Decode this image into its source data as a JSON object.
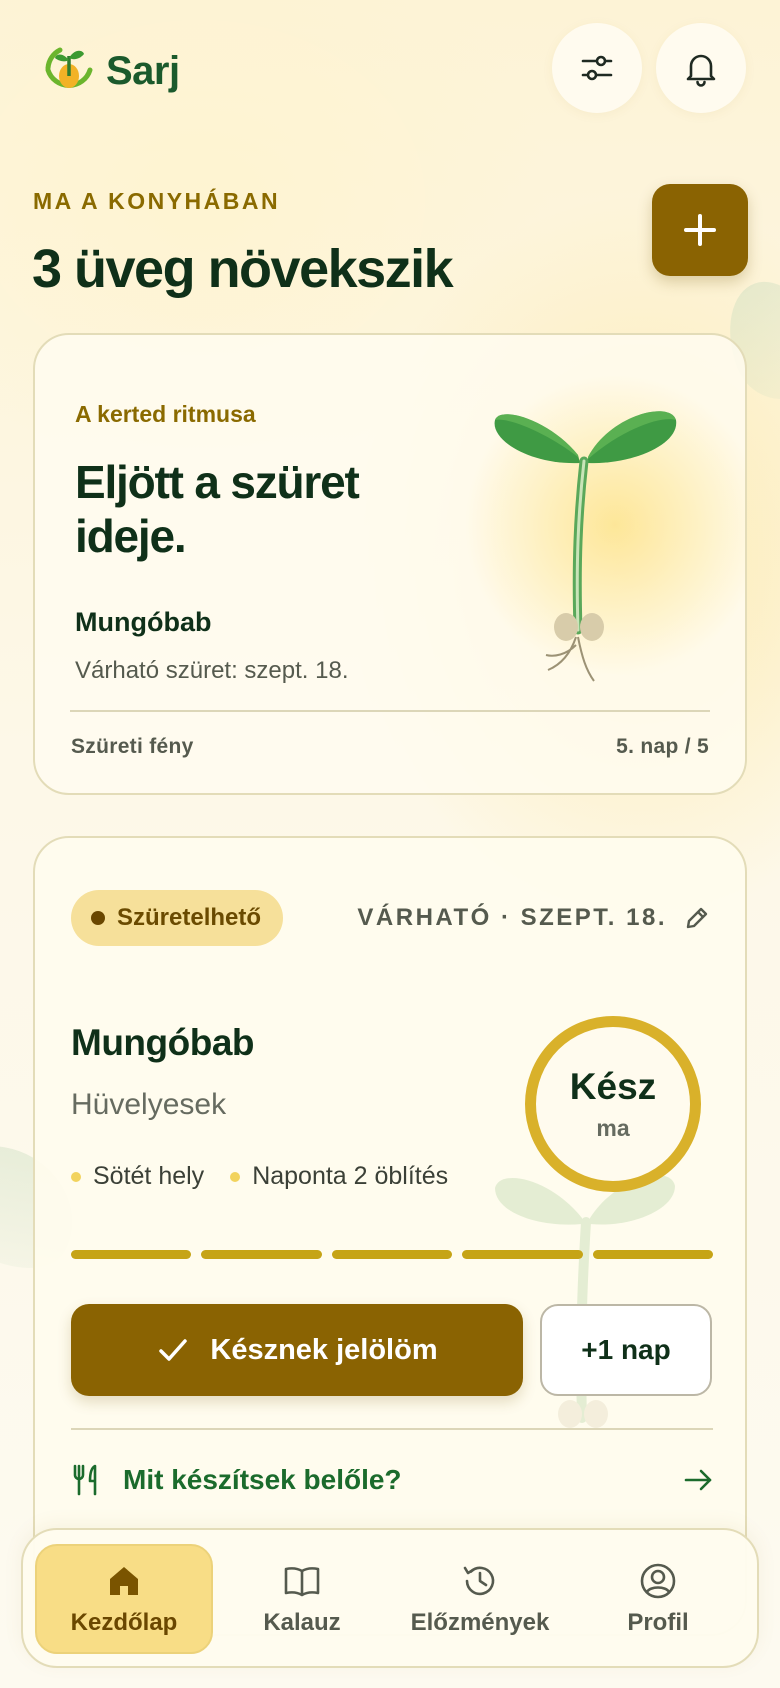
{
  "app": {
    "name": "Sarj"
  },
  "header": {
    "filter_icon": "sliders-icon",
    "bell_icon": "bell-icon"
  },
  "intro": {
    "eyebrow": "MA A KONYHÁBAN",
    "title": "3 üveg növekszik",
    "add_icon": "plus-icon"
  },
  "rhythm_card": {
    "kicker": "A kerted ritmusa",
    "headline": "Eljött a szüret ideje.",
    "crop": "Mungóbab",
    "expected": "Várható szüret: szept. 18.",
    "footer_left": "Szüreti fény",
    "footer_right": "5. nap / 5"
  },
  "jar_card": {
    "status": "Szüretelhető",
    "expected_label": "VÁRHATÓ · SZEPT. 18.",
    "name": "Mungóbab",
    "family": "Hüvelyesek",
    "tags": [
      "Sötét hely",
      "Naponta 2 öblítés"
    ],
    "ring_main": "Kész",
    "ring_sub": "ma",
    "progress": {
      "completed": 5,
      "total": 5
    },
    "primary_button": "Késznek jelölöm",
    "secondary_button": "+1 nap",
    "recipe_link": "Mit készítsek belőle?"
  },
  "nav": {
    "items": [
      {
        "label": "Kezdőlap",
        "icon": "home-icon",
        "active": true
      },
      {
        "label": "Kalauz",
        "icon": "book-icon",
        "active": false
      },
      {
        "label": "Előzmények",
        "icon": "history-icon",
        "active": false
      },
      {
        "label": "Profil",
        "icon": "profile-icon",
        "active": false
      }
    ]
  },
  "colors": {
    "accent": "#8a6302",
    "brand_green": "#1b5a2c",
    "ring": "#d9b12a",
    "background": "#fdf8e8"
  }
}
